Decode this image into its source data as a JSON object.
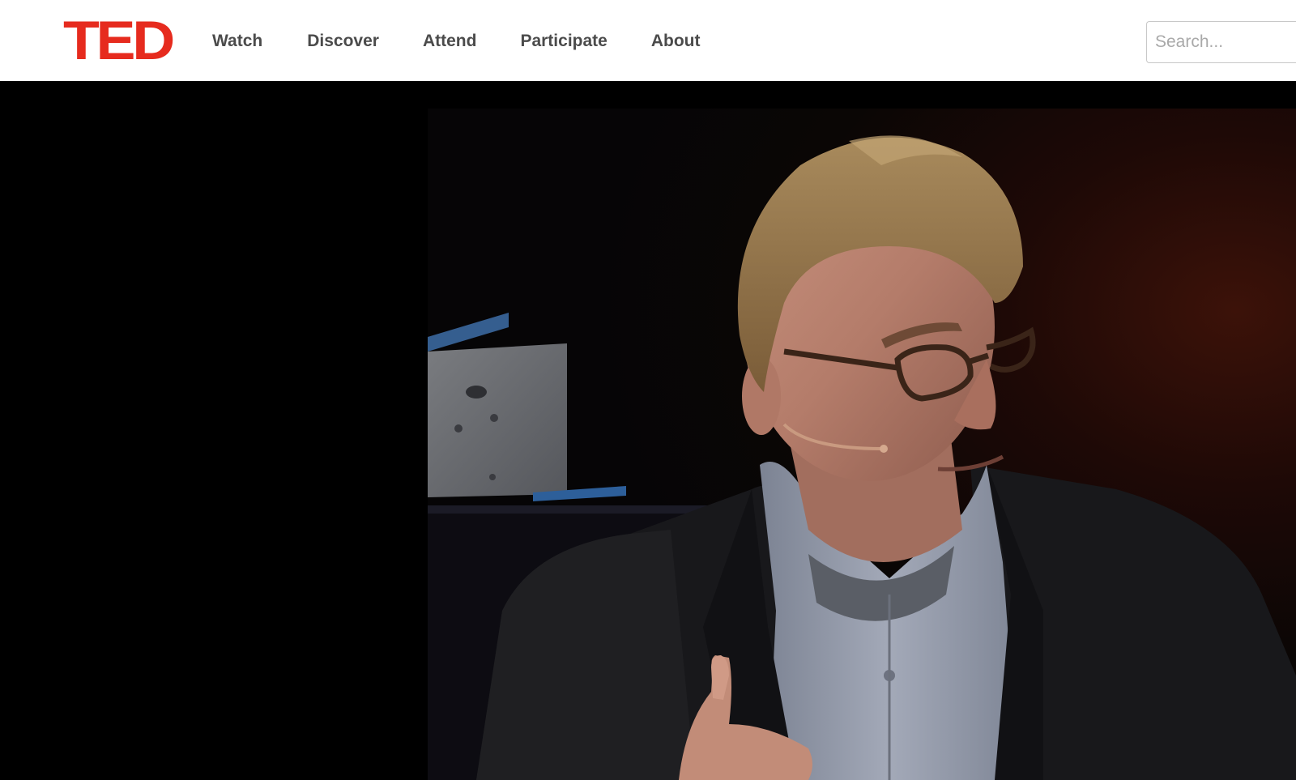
{
  "header": {
    "logo_text": "TED",
    "nav": [
      {
        "label": "Watch"
      },
      {
        "label": "Discover"
      },
      {
        "label": "Attend"
      },
      {
        "label": "Participate"
      },
      {
        "label": "About"
      }
    ],
    "search": {
      "placeholder": "Search...",
      "value": ""
    }
  },
  "player": {
    "content": "speaker-video-frame"
  },
  "colors": {
    "brand_red": "#e62b1e",
    "nav_text": "#4b4b4b",
    "header_bg": "#ffffff",
    "stage_bg": "#000000"
  }
}
